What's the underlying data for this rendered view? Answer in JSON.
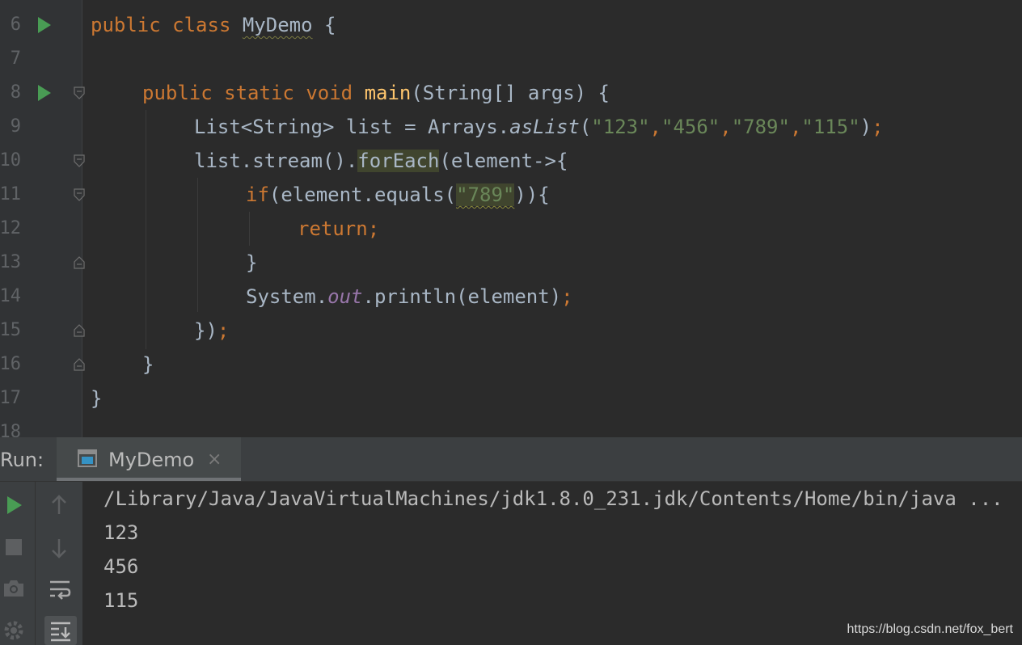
{
  "editor": {
    "line_numbers": [
      "6",
      "7",
      "8",
      "9",
      "10",
      "11",
      "12",
      "13",
      "14",
      "15",
      "16",
      "17",
      "18"
    ],
    "lines": {
      "l6": {
        "kw1": "public",
        "kw2": "class",
        "classname": "MyDemo",
        "brace": "{"
      },
      "l8": {
        "kw1": "public",
        "kw2": "static",
        "kw3": "void",
        "method": "main",
        "params": "(String[] args) {"
      },
      "l9": {
        "pre": "List<String> list = Arrays.",
        "call": "asList",
        "open": "(",
        "s1": "\"123\"",
        "s2": "\"456\"",
        "s3": "\"789\"",
        "s4": "\"115\"",
        "close": ")",
        "semi": ";",
        "comma": ","
      },
      "l10": {
        "pre": "list.stream().",
        "call": "forEach",
        "post": "(element->{"
      },
      "l11": {
        "kw": "if",
        "pre": "(element.equals(",
        "str": "\"789\"",
        "post": ")){"
      },
      "l12": {
        "kw": "return",
        "semi": ";"
      },
      "l13": {
        "text": "}"
      },
      "l14": {
        "pre": "System.",
        "field": "out",
        "post": ".println(element)",
        "semi": ";"
      },
      "l15": {
        "pre": "})",
        "semi": ";"
      },
      "l16": {
        "text": "}"
      },
      "l17": {
        "text": "}"
      }
    }
  },
  "run_panel": {
    "label": "Run:",
    "tab_label": "MyDemo",
    "tab_close": "×",
    "tab_icon": "console-window-icon",
    "tools_left": [
      "rerun-icon",
      "stop-icon",
      "screenshot-icon",
      "settings-icon"
    ],
    "tools_right": [
      "scroll-up-icon",
      "scroll-down-icon",
      "soft-wrap-icon",
      "scroll-to-end-icon"
    ]
  },
  "console": {
    "lines": [
      "/Library/Java/JavaVirtualMachines/jdk1.8.0_231.jdk/Contents/Home/bin/java ...",
      "123",
      "456",
      "115"
    ]
  },
  "watermark": "https://blog.csdn.net/fox_bert",
  "colors": {
    "background": "#2b2b2b",
    "keyword": "#cc7832",
    "method": "#ffc66d",
    "string": "#6a8759",
    "field": "#9876aa",
    "text": "#a9b7c6",
    "run_green": "#499c54"
  }
}
